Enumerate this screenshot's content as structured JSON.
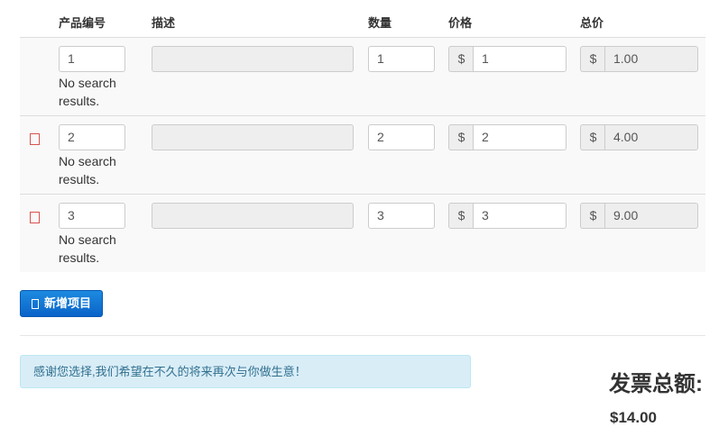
{
  "table": {
    "headers": {
      "code": "产品编号",
      "desc": "描述",
      "qty": "数量",
      "price": "价格",
      "total": "总价"
    },
    "currency_symbol": "$",
    "rows": [
      {
        "code": "1",
        "desc": "",
        "qty": "1",
        "price": "1",
        "total": "1.00",
        "search_status": "No search results.",
        "deletable": false
      },
      {
        "code": "2",
        "desc": "",
        "qty": "2",
        "price": "2",
        "total": "4.00",
        "search_status": "No search results.",
        "deletable": true
      },
      {
        "code": "3",
        "desc": "",
        "qty": "3",
        "price": "3",
        "total": "9.00",
        "search_status": "No search results.",
        "deletable": true
      }
    ]
  },
  "add_item_button": {
    "label": "新增项目"
  },
  "note": "感谢您选择,我们希望在不久的将来再次与你做生意！",
  "invoice_total": {
    "title": "发票总额:",
    "value": "$14.00"
  },
  "colors": {
    "delete_icon": "#d9534f",
    "primary_button": "#0a64c8",
    "note_bg": "#d9edf7"
  }
}
